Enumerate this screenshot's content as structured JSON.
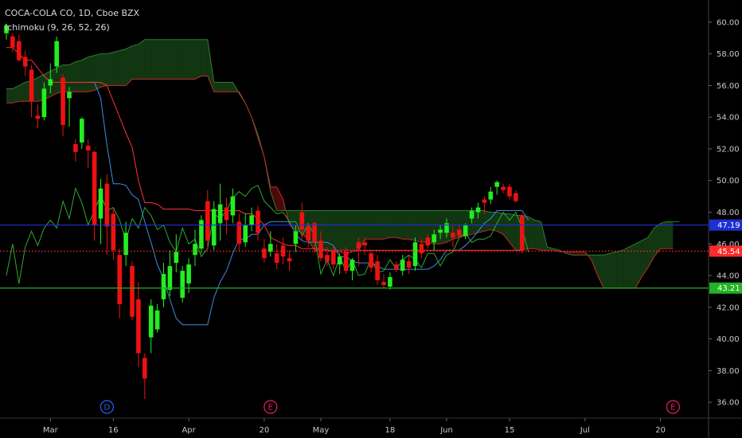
{
  "header": {
    "symbol_line": "COCA-COLA CO, 1D, Cboe BZX",
    "indicator_line": "Ichimoku (9, 26, 52, 26)"
  },
  "chart_data": {
    "type": "candlestick",
    "ylim": [
      35.0,
      61.4
    ],
    "y_ticks": [
      "36.00",
      "38.00",
      "40.00",
      "42.00",
      "44.00",
      "46.00",
      "48.00",
      "50.00",
      "52.00",
      "54.00",
      "56.00",
      "58.00",
      "60.00"
    ],
    "x_ticks": [
      {
        "label": "Mar",
        "bar": 7
      },
      {
        "label": "16",
        "bar": 17
      },
      {
        "label": "Apr",
        "bar": 29
      },
      {
        "label": "20",
        "bar": 41
      },
      {
        "label": "May",
        "bar": 50
      },
      {
        "label": "18",
        "bar": 61
      },
      {
        "label": "Jun",
        "bar": 70
      },
      {
        "label": "15",
        "bar": 80
      },
      {
        "label": "Jul",
        "bar": 92
      },
      {
        "label": "20",
        "bar": 104
      }
    ],
    "price_tags": [
      {
        "label": "47.19",
        "value": 47.19,
        "color": "#1f2fd6",
        "line": "solid"
      },
      {
        "label": "45.54",
        "value": 45.54,
        "color": "#ff2a2a",
        "line": "dotted"
      },
      {
        "label": "43.21",
        "value": 43.21,
        "color": "#22b322",
        "line": "solid"
      }
    ],
    "events": [
      {
        "label": "D",
        "bar": 16,
        "color": "#2962ff"
      },
      {
        "label": "E",
        "bar": 42,
        "color": "#e91e63"
      },
      {
        "label": "E",
        "bar": 106,
        "color": "#e91e63"
      }
    ],
    "candles": [
      [
        59.3,
        59.9,
        58.9,
        59.8
      ],
      [
        59.1,
        59.3,
        58.1,
        58.4
      ],
      [
        58.8,
        59.2,
        57.5,
        57.6
      ],
      [
        57.8,
        58.2,
        56.6,
        57.2
      ],
      [
        57.0,
        57.3,
        54.0,
        55.0
      ],
      [
        54.1,
        54.8,
        53.3,
        53.9
      ],
      [
        54.0,
        56.2,
        53.8,
        55.8
      ],
      [
        56.0,
        57.4,
        55.5,
        56.4
      ],
      [
        57.2,
        59.1,
        56.8,
        58.8
      ],
      [
        56.5,
        56.7,
        52.8,
        53.5
      ],
      [
        55.2,
        55.9,
        53.4,
        55.6
      ],
      [
        52.3,
        52.6,
        51.2,
        51.8
      ],
      [
        52.4,
        54.0,
        52.0,
        53.9
      ],
      [
        52.2,
        52.6,
        50.8,
        51.9
      ],
      [
        51.8,
        51.9,
        46.2,
        47.2
      ],
      [
        47.6,
        50.1,
        46.0,
        49.5
      ],
      [
        49.8,
        50.4,
        45.3,
        47.1
      ],
      [
        47.9,
        48.3,
        45.0,
        45.6
      ],
      [
        45.3,
        45.7,
        41.3,
        42.2
      ],
      [
        45.3,
        47.4,
        44.6,
        46.7
      ],
      [
        44.6,
        44.9,
        41.2,
        41.4
      ],
      [
        42.5,
        43.6,
        38.2,
        39.1
      ],
      [
        38.8,
        39.1,
        36.2,
        37.5
      ],
      [
        40.1,
        42.5,
        39.1,
        42.1
      ],
      [
        40.6,
        42.2,
        40.4,
        41.8
      ],
      [
        42.5,
        44.8,
        42.0,
        44.1
      ],
      [
        43.1,
        45.6,
        42.7,
        44.6
      ],
      [
        44.8,
        46.6,
        44.2,
        45.5
      ],
      [
        42.6,
        44.6,
        42.3,
        44.3
      ],
      [
        43.5,
        45.1,
        42.9,
        44.7
      ],
      [
        45.3,
        46.9,
        44.6,
        46.0
      ],
      [
        45.7,
        47.8,
        45.4,
        47.5
      ],
      [
        48.7,
        49.4,
        45.7,
        46.2
      ],
      [
        45.9,
        48.7,
        45.6,
        48.2
      ],
      [
        47.3,
        49.8,
        46.2,
        48.5
      ],
      [
        48.3,
        48.9,
        46.6,
        47.5
      ],
      [
        47.8,
        49.5,
        47.3,
        49.0
      ],
      [
        47.4,
        47.9,
        45.5,
        46.0
      ],
      [
        46.1,
        47.9,
        45.8,
        47.2
      ],
      [
        47.2,
        48.3,
        46.8,
        47.8
      ],
      [
        48.1,
        48.4,
        46.2,
        46.7
      ],
      [
        45.7,
        46.3,
        44.8,
        45.1
      ],
      [
        45.5,
        46.8,
        45.2,
        46.0
      ],
      [
        45.4,
        46.0,
        44.4,
        44.8
      ],
      [
        45.9,
        46.4,
        44.7,
        45.2
      ],
      [
        45.1,
        45.6,
        44.3,
        44.9
      ],
      [
        46.0,
        47.2,
        45.5,
        46.8
      ],
      [
        48.0,
        48.6,
        46.2,
        46.9
      ],
      [
        47.1,
        47.3,
        45.8,
        46.2
      ],
      [
        47.3,
        47.4,
        45.4,
        46.1
      ],
      [
        46.2,
        46.8,
        44.9,
        45.1
      ],
      [
        45.3,
        45.8,
        44.6,
        44.9
      ],
      [
        45.6,
        45.9,
        44.4,
        44.7
      ],
      [
        44.7,
        45.4,
        44.1,
        45.2
      ],
      [
        45.5,
        45.8,
        44.1,
        44.3
      ],
      [
        44.3,
        45.1,
        43.7,
        45.0
      ],
      [
        46.1,
        46.4,
        44.6,
        45.7
      ],
      [
        46.1,
        46.4,
        45.3,
        45.9
      ],
      [
        45.4,
        45.6,
        44.2,
        44.5
      ],
      [
        44.9,
        45.3,
        43.4,
        43.7
      ],
      [
        43.6,
        44.1,
        43.2,
        43.4
      ],
      [
        43.3,
        44.2,
        43.1,
        43.9
      ],
      [
        44.7,
        44.9,
        44.2,
        44.4
      ],
      [
        44.3,
        45.3,
        44.0,
        45.0
      ],
      [
        44.9,
        45.3,
        44.1,
        44.5
      ],
      [
        44.6,
        46.4,
        44.3,
        46.1
      ],
      [
        46.0,
        46.3,
        45.1,
        45.4
      ],
      [
        46.4,
        46.6,
        45.7,
        45.9
      ],
      [
        46.1,
        46.9,
        45.6,
        46.6
      ],
      [
        46.7,
        47.2,
        46.3,
        46.9
      ],
      [
        46.7,
        47.6,
        46.4,
        47.3
      ],
      [
        46.7,
        47.1,
        45.8,
        46.4
      ],
      [
        46.9,
        47.2,
        46.3,
        46.5
      ],
      [
        46.5,
        47.3,
        46.3,
        47.2
      ],
      [
        47.6,
        48.3,
        47.3,
        48.1
      ],
      [
        48.0,
        48.6,
        47.6,
        48.3
      ],
      [
        48.8,
        49.0,
        47.9,
        48.6
      ],
      [
        48.8,
        49.6,
        48.5,
        49.3
      ],
      [
        49.6,
        50.0,
        49.1,
        49.9
      ],
      [
        49.6,
        49.8,
        49.2,
        49.4
      ],
      [
        49.6,
        49.8,
        48.8,
        49.0
      ],
      [
        49.2,
        49.4,
        48.6,
        48.7
      ],
      [
        47.8,
        47.9,
        45.4,
        45.6
      ]
    ],
    "series": [
      {
        "key": "tenkan",
        "color": "#3c8dde",
        "start": 13,
        "values": [
          56.2,
          56.2,
          55.2,
          52.2,
          49.8,
          49.8,
          49.7,
          49.1,
          48.8,
          47.4,
          46.1,
          44.7,
          43.8,
          42.5,
          41.3,
          40.9,
          40.9,
          40.9,
          40.9,
          40.9,
          42.6,
          43.6,
          44.3,
          45.4,
          46.3,
          46.3,
          46.6,
          46.6,
          47.2,
          47.4,
          47.4,
          47.4,
          47.4,
          46.6,
          46.2,
          46.1,
          46.1,
          46.1,
          46.1,
          45.9,
          45.2,
          45.2,
          44.9,
          44.8,
          44.8,
          44.8,
          44.6,
          44.4,
          44.4,
          44.4,
          44.4,
          44.4,
          44.4,
          44.4,
          44.4,
          44.6,
          45.0,
          45.6,
          45.6,
          45.6,
          45.9,
          46.3,
          46.8,
          47.3,
          47.6,
          48.1,
          48.1,
          48.1,
          48.1,
          48.1,
          47.5
        ]
      },
      {
        "key": "kijun",
        "color": "#ff3333",
        "start": 0,
        "values": [
          58.4,
          58.4,
          58.0,
          57.6,
          57.6,
          57.1,
          56.6,
          56.2,
          56.2,
          56.2,
          56.2,
          56.2,
          56.2,
          56.2,
          56.2,
          56.2,
          56.0,
          55.0,
          54.0,
          53.0,
          52.1,
          50.0,
          48.6,
          48.6,
          48.5,
          48.2,
          48.2,
          48.2,
          48.2,
          48.2,
          48.1,
          48.1,
          48.1,
          48.1,
          48.1,
          48.1,
          48.1,
          48.1,
          47.9,
          47.9,
          47.6,
          47.2,
          46.4,
          46.2,
          46.0,
          45.9,
          45.9,
          45.7,
          45.7,
          45.7,
          45.7,
          45.6,
          45.5,
          45.5,
          45.4,
          45.5,
          45.6,
          45.6,
          45.6,
          45.6,
          45.6,
          45.6,
          45.6,
          45.6,
          45.6,
          45.6,
          45.6,
          45.6,
          45.6,
          45.6,
          45.6,
          45.6,
          45.6,
          45.6,
          45.6,
          45.6,
          45.6,
          45.6,
          45.6,
          45.6,
          45.6,
          45.6,
          45.6
        ]
      },
      {
        "key": "chikou",
        "color": "#32a832",
        "start": 0,
        "values": [
          44.0,
          46.0,
          43.5,
          45.8,
          46.8,
          45.9,
          47.0,
          47.5,
          47.0,
          48.7,
          47.6,
          49.5,
          48.6,
          47.2,
          48.1,
          49.1,
          48.1,
          48.3,
          47.5,
          46.2,
          47.6,
          47.0,
          48.3,
          47.8,
          46.9,
          47.2,
          46.1,
          45.5,
          47.0,
          46.0,
          46.3,
          45.2,
          45.7,
          47.9,
          47.6,
          48.1,
          48.9,
          49.3,
          49.0,
          49.5,
          49.7,
          48.7,
          48.3,
          47.9,
          48.0,
          47.4,
          47.4,
          46.5,
          47.3,
          46.5,
          44.1,
          45.0,
          44.0,
          45.2,
          44.3,
          45.0,
          44.0,
          44.1,
          45.1,
          44.2,
          44.3,
          45.0,
          44.4,
          45.0,
          45.3,
          45.0,
          44.5,
          45.4,
          45.4,
          44.6,
          45.3,
          45.5,
          46.4,
          46.7,
          46.1,
          46.3,
          46.3,
          46.5,
          47.3,
          48.0,
          47.5,
          48.0,
          47.0,
          45.5
        ]
      }
    ],
    "cloud": {
      "start": 0,
      "span_a": [
        55.8,
        55.8,
        56.0,
        56.2,
        56.3,
        56.5,
        56.7,
        56.9,
        57.1,
        57.3,
        57.3,
        57.5,
        57.6,
        57.8,
        57.9,
        58.0,
        58.0,
        58.1,
        58.2,
        58.3,
        58.5,
        58.6,
        58.9,
        58.9,
        58.9,
        58.9,
        58.9,
        58.9,
        58.9,
        58.9,
        58.9,
        58.9,
        58.9,
        56.2,
        56.2,
        56.2,
        56.2,
        55.5,
        54.9,
        54.0,
        52.9,
        51.5,
        49.3,
        48.1,
        48.1,
        48.1,
        48.1,
        48.1,
        48.1,
        48.1,
        48.1,
        48.1,
        48.1,
        48.1,
        48.1,
        48.1,
        48.1,
        48.1,
        48.1,
        48.1,
        48.1,
        48.1,
        48.1,
        48.1,
        48.1,
        48.1,
        48.1,
        48.1,
        48.1,
        48.1,
        48.1,
        48.1,
        48.1,
        48.1,
        48.1,
        48.1,
        48.1,
        48.0,
        48.0,
        47.9,
        47.9,
        47.8,
        47.8,
        47.7,
        47.5,
        47.4,
        45.8,
        45.7,
        45.6,
        45.4,
        45.3,
        45.3,
        45.3,
        45.3,
        45.3,
        45.3,
        45.4,
        45.5,
        45.6,
        45.8,
        46.0,
        46.2,
        46.4,
        47.0,
        47.3,
        47.4,
        47.4,
        47.4
      ],
      "span_b": [
        54.9,
        54.9,
        55.0,
        55.0,
        55.0,
        55.0,
        55.1,
        55.3,
        55.5,
        55.6,
        55.6,
        55.6,
        55.6,
        55.6,
        55.7,
        55.9,
        56.0,
        56.0,
        56.0,
        56.0,
        56.4,
        56.4,
        56.4,
        56.4,
        56.4,
        56.4,
        56.4,
        56.4,
        56.4,
        56.4,
        56.4,
        56.6,
        56.6,
        55.6,
        55.6,
        55.6,
        55.6,
        55.6,
        54.9,
        54.0,
        52.7,
        51.5,
        49.6,
        49.6,
        48.8,
        47.2,
        46.9,
        46.7,
        46.2,
        45.6,
        45.6,
        45.6,
        45.6,
        45.6,
        45.6,
        45.6,
        45.6,
        46.3,
        46.3,
        46.3,
        46.3,
        46.4,
        46.4,
        46.3,
        46.3,
        46.2,
        46.1,
        46.1,
        46.0,
        46.0,
        46.1,
        46.3,
        46.4,
        46.5,
        46.6,
        46.7,
        46.8,
        46.9,
        46.8,
        46.6,
        46.1,
        45.6,
        45.6,
        45.7,
        45.7,
        45.6,
        45.6,
        45.6,
        45.5,
        45.5,
        45.5,
        45.5,
        45.5,
        45.0,
        44.0,
        43.2,
        43.2,
        43.2,
        43.2,
        43.2,
        43.2,
        43.9,
        44.5,
        45.2,
        45.7,
        45.7,
        45.7
      ]
    }
  }
}
